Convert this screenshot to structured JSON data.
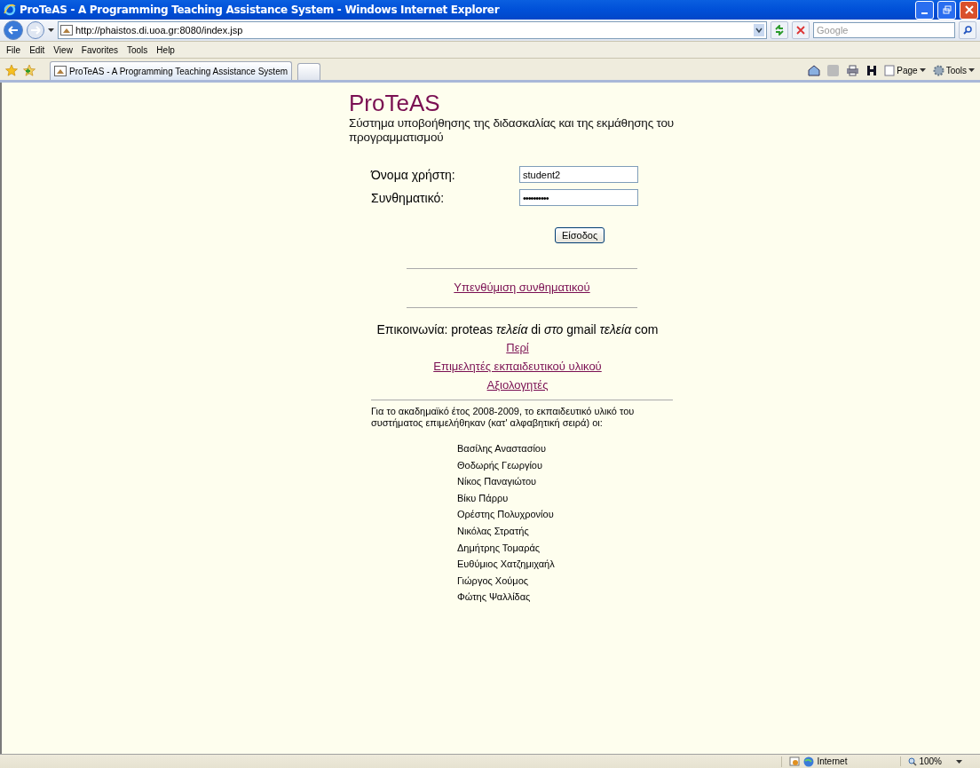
{
  "window": {
    "title": "ProTeAS - A Programming Teaching Assistance System - Windows Internet Explorer"
  },
  "address_bar": {
    "url": "http://phaistos.di.uoa.gr:8080/index.jsp"
  },
  "search": {
    "placeholder": "Google"
  },
  "menu": [
    "File",
    "Edit",
    "View",
    "Favorites",
    "Tools",
    "Help"
  ],
  "tabs": [
    {
      "label": "ProTeAS - A Programming Teaching Assistance System",
      "selected": true
    }
  ],
  "command_bar": [
    "Page",
    "Tools"
  ],
  "page": {
    "title": "ProTeAS",
    "subtitle": "Σύστημα υποβοήθησης της διδασκαλίας και της εκμάθησης του προγραμματισμού",
    "fields": [
      {
        "label": "Όνομα χρήστη:",
        "value": "student2"
      },
      {
        "label": "Συνθηματικό:",
        "value": "••••••••••"
      }
    ],
    "login_button": "Είσοδος",
    "reminder_link": "Υπενθύμιση συνθηματικού",
    "contact": "Επικοινωνία: proteas *τελεία* di *στο* gmail *τελεία* com",
    "links": [
      "Περί",
      "Επιμελητές εκπαιδευτικού υλικού",
      "Αξιολογητές"
    ],
    "credits_intro": "Για το ακαδημαϊκό έτος 2008-2009, το εκπαιδευτικό υλικό του συστήματος επιμελήθηκαν (κατ' αλφαβητική σειρά) οι:",
    "credits": [
      "Βασίλης Αναστασίου",
      "Θοδωρής Γεωργίου",
      "Νίκος Παναγιώτου",
      "Βίκυ Πάρρυ",
      "Ορέστης Πολυχρονίου",
      "Νικόλας Στρατής",
      "Δημήτρης Τομαράς",
      "Ευθύμιος Χατζημιχαήλ",
      "Γιώργος Χούμος",
      "Φώτης Ψαλλίδας"
    ]
  },
  "status_bar": {
    "zone": "Internet",
    "zoom": "100%"
  }
}
